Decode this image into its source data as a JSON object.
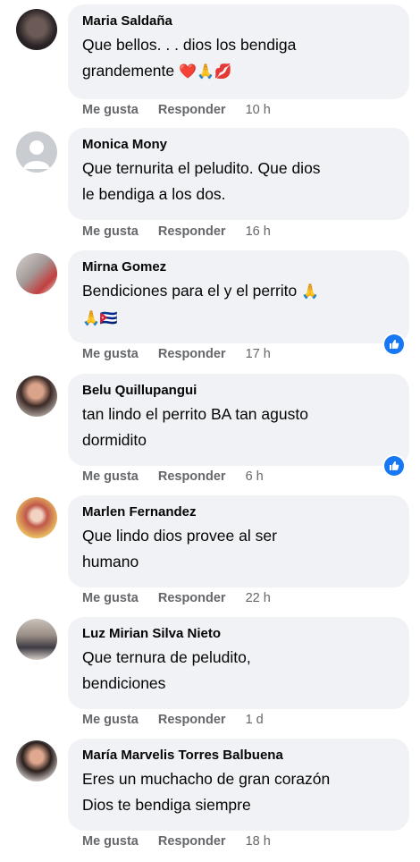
{
  "actions": {
    "like": "Me gusta",
    "reply": "Responder"
  },
  "comments": [
    {
      "author": "Maria Saldaña",
      "line1": "Que bellos. . . dios los bendiga",
      "line2": "grandemente",
      "emoji": "❤️🙏💋",
      "time": "10 h",
      "reacted": false
    },
    {
      "author": "Monica Mony",
      "line1": "Que ternurita el peludito. Que dios",
      "line2": "le bendiga a los dos.",
      "emoji": "",
      "time": "16 h",
      "reacted": false
    },
    {
      "author": "Mirna Gomez",
      "line1": "Bendiciones para el y el perrito",
      "line1_emoji": "🙏",
      "line2": "",
      "emoji": "🙏🇨🇺",
      "time": "17 h",
      "reacted": true
    },
    {
      "author": "Belu Quillupangui",
      "line1": "tan lindo el perrito BA tan agusto",
      "line2": "dormidito",
      "emoji": "",
      "time": "6 h",
      "reacted": true
    },
    {
      "author": "Marlen Fernandez",
      "line1": "Que lindo dios provee al ser",
      "line2": "humano",
      "emoji": "",
      "time": "22 h",
      "reacted": false
    },
    {
      "author": "Luz Mirian Silva Nieto",
      "line1": "Que ternura de peludito,",
      "line2": "bendiciones",
      "emoji": "",
      "time": "1 d",
      "reacted": false
    },
    {
      "author": "María Marvelis Torres Balbuena",
      "line1": "Eres un muchacho de gran corazón",
      "line2": "Dios te bendiga siempre",
      "emoji": "",
      "time": "18 h",
      "reacted": false
    }
  ]
}
